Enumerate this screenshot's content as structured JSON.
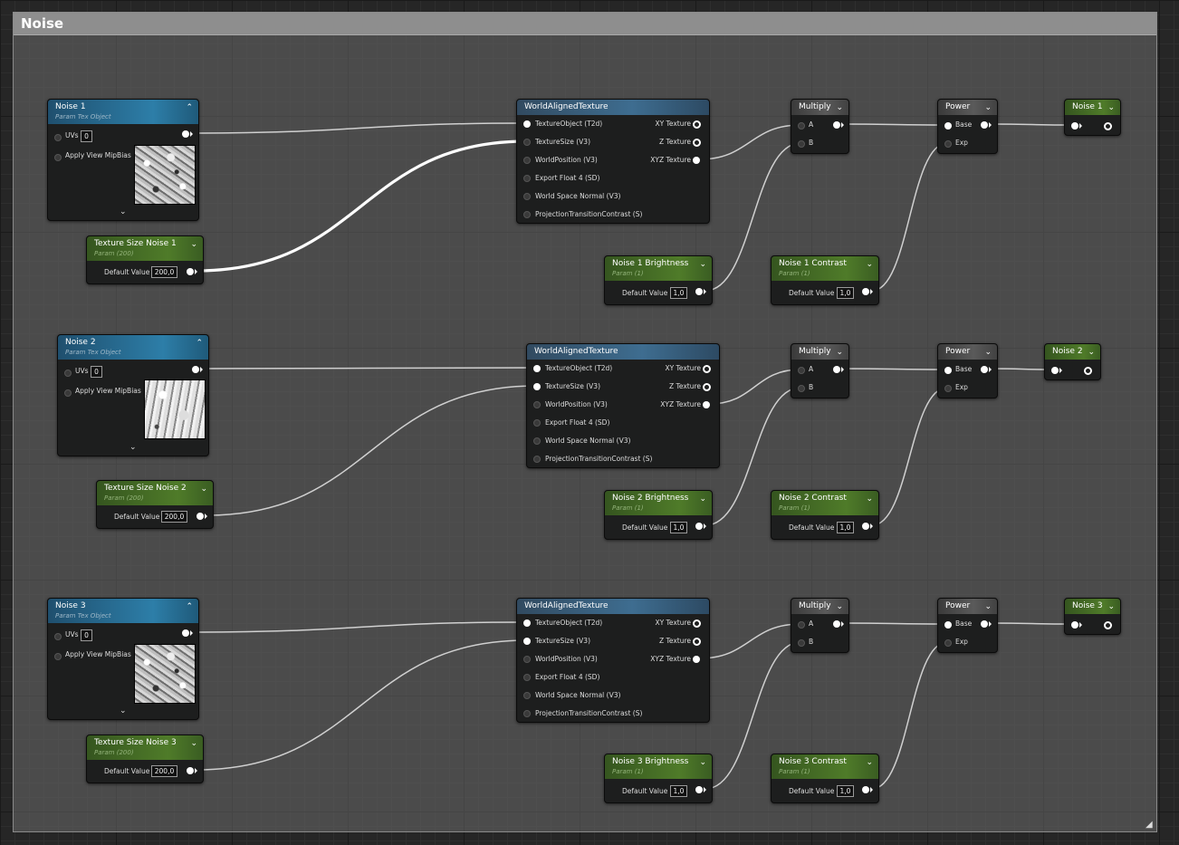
{
  "comment": {
    "title": "Noise"
  },
  "groups": [
    {
      "tex": {
        "title": "Noise 1",
        "subtitle": "Param Tex Object",
        "uvs_label": "UVs",
        "uvs_value": "0",
        "mip_label": "Apply View MipBias"
      },
      "size": {
        "title": "Texture Size Noise 1",
        "subtitle": "Param (200)",
        "label": "Default Value",
        "value": "200,0"
      },
      "wat": {
        "title": "WorldAlignedTexture",
        "inputs": [
          "TextureObject (T2d)",
          "TextureSize (V3)",
          "WorldPosition (V3)",
          "Export Float 4 (SD)",
          "World Space Normal (V3)",
          "ProjectionTransitionContrast (S)"
        ],
        "outputs": [
          "XY Texture",
          "Z Texture",
          "XYZ Texture"
        ]
      },
      "multiply": {
        "title": "Multiply",
        "a": "A",
        "b": "B"
      },
      "power": {
        "title": "Power",
        "base": "Base",
        "exp": "Exp"
      },
      "brightness": {
        "title": "Noise 1 Brightness",
        "subtitle": "Param (1)",
        "label": "Default Value",
        "value": "1,0"
      },
      "contrast": {
        "title": "Noise 1 Contrast",
        "subtitle": "Param (1)",
        "label": "Default Value",
        "value": "1,0"
      },
      "output": {
        "title": "Noise 1"
      }
    },
    {
      "tex": {
        "title": "Noise 2",
        "subtitle": "Param Tex Object",
        "uvs_label": "UVs",
        "uvs_value": "0",
        "mip_label": "Apply View MipBias"
      },
      "size": {
        "title": "Texture Size Noise 2",
        "subtitle": "Param (200)",
        "label": "Default Value",
        "value": "200,0"
      },
      "wat": {
        "title": "WorldAlignedTexture",
        "inputs": [
          "TextureObject (T2d)",
          "TextureSize (V3)",
          "WorldPosition (V3)",
          "Export Float 4 (SD)",
          "World Space Normal (V3)",
          "ProjectionTransitionContrast (S)"
        ],
        "outputs": [
          "XY Texture",
          "Z Texture",
          "XYZ Texture"
        ]
      },
      "multiply": {
        "title": "Multiply",
        "a": "A",
        "b": "B"
      },
      "power": {
        "title": "Power",
        "base": "Base",
        "exp": "Exp"
      },
      "brightness": {
        "title": "Noise 2 Brightness",
        "subtitle": "Param (1)",
        "label": "Default Value",
        "value": "1,0"
      },
      "contrast": {
        "title": "Noise 2 Contrast",
        "subtitle": "Param (1)",
        "label": "Default Value",
        "value": "1,0"
      },
      "output": {
        "title": "Noise 2"
      }
    },
    {
      "tex": {
        "title": "Noise 3",
        "subtitle": "Param Tex Object",
        "uvs_label": "UVs",
        "uvs_value": "0",
        "mip_label": "Apply View MipBias"
      },
      "size": {
        "title": "Texture Size Noise 3",
        "subtitle": "Param (200)",
        "label": "Default Value",
        "value": "200,0"
      },
      "wat": {
        "title": "WorldAlignedTexture",
        "inputs": [
          "TextureObject (T2d)",
          "TextureSize (V3)",
          "WorldPosition (V3)",
          "Export Float 4 (SD)",
          "World Space Normal (V3)",
          "ProjectionTransitionContrast (S)"
        ],
        "outputs": [
          "XY Texture",
          "Z Texture",
          "XYZ Texture"
        ]
      },
      "multiply": {
        "title": "Multiply",
        "a": "A",
        "b": "B"
      },
      "power": {
        "title": "Power",
        "base": "Base",
        "exp": "Exp"
      },
      "brightness": {
        "title": "Noise 3 Brightness",
        "subtitle": "Param (1)",
        "label": "Default Value",
        "value": "1,0"
      },
      "contrast": {
        "title": "Noise 3 Contrast",
        "subtitle": "Param (1)",
        "label": "Default Value",
        "value": "1,0"
      },
      "output": {
        "title": "Noise 3"
      }
    }
  ]
}
